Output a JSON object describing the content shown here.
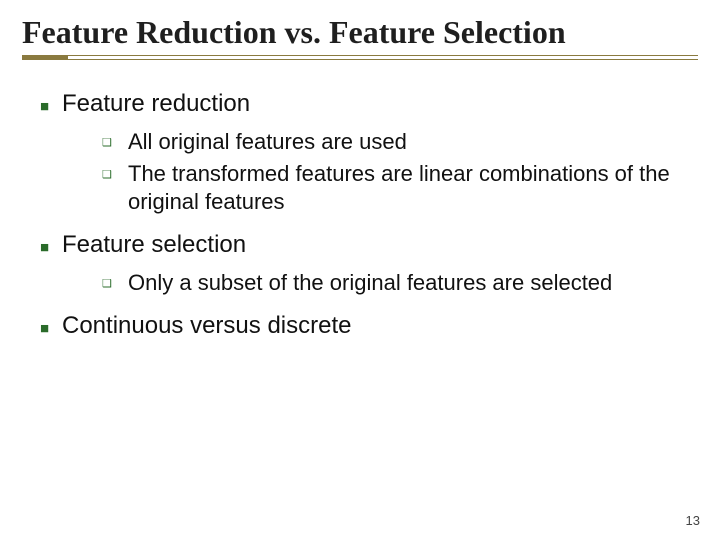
{
  "title": "Feature Reduction vs. Feature Selection",
  "items": [
    {
      "label": "Feature reduction",
      "sub": [
        "All original features are used",
        "The transformed features are linear combinations of the original features"
      ]
    },
    {
      "label": "Feature selection",
      "sub": [
        "Only a subset of the original features are selected"
      ]
    },
    {
      "label": "Continuous versus discrete",
      "sub": []
    }
  ],
  "page_number": "13"
}
